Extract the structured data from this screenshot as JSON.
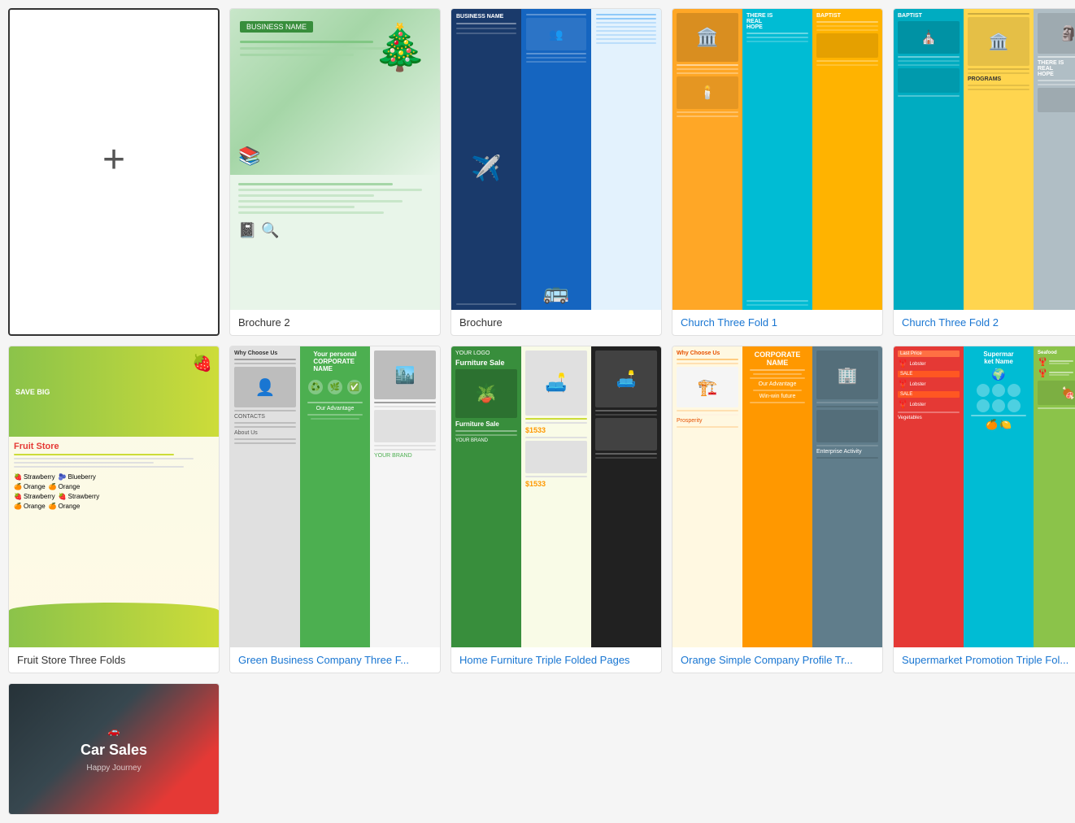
{
  "cards": [
    {
      "id": "new-document",
      "label": "",
      "labelHtml": "",
      "type": "new"
    },
    {
      "id": "brochure2",
      "label": "Brochure 2",
      "labelColor": "plain",
      "type": "brochure2"
    },
    {
      "id": "brochure",
      "label": "Brochure",
      "labelColor": "plain",
      "type": "brochure"
    },
    {
      "id": "church-fold-1",
      "label": "Church Three Fold 1",
      "labelColor": "blue",
      "type": "church1"
    },
    {
      "id": "church-fold-2",
      "label": "Church Three Fold 2",
      "labelColor": "blue",
      "type": "church2"
    },
    {
      "id": "fruit-store",
      "label": "Fruit Store Three Folds",
      "labelColor": "plain",
      "type": "fruit"
    },
    {
      "id": "green-biz",
      "label": "Green Business Company Three F...",
      "labelColor": "blue",
      "type": "greenbiz"
    },
    {
      "id": "home-furniture",
      "label": "Home Furniture Triple Folded Pages",
      "labelColor": "blue",
      "type": "furniture"
    },
    {
      "id": "orange-company",
      "label": "Orange Simple Company Profile Tr...",
      "labelColor": "blue",
      "type": "orange"
    },
    {
      "id": "supermarket",
      "label": "Supermarket Promotion Triple Fol...",
      "labelColor": "blue",
      "type": "supermarket"
    },
    {
      "id": "car-sales",
      "label": "",
      "labelColor": "plain",
      "type": "car",
      "partial": true
    }
  ],
  "icons": {
    "plus": "+"
  }
}
